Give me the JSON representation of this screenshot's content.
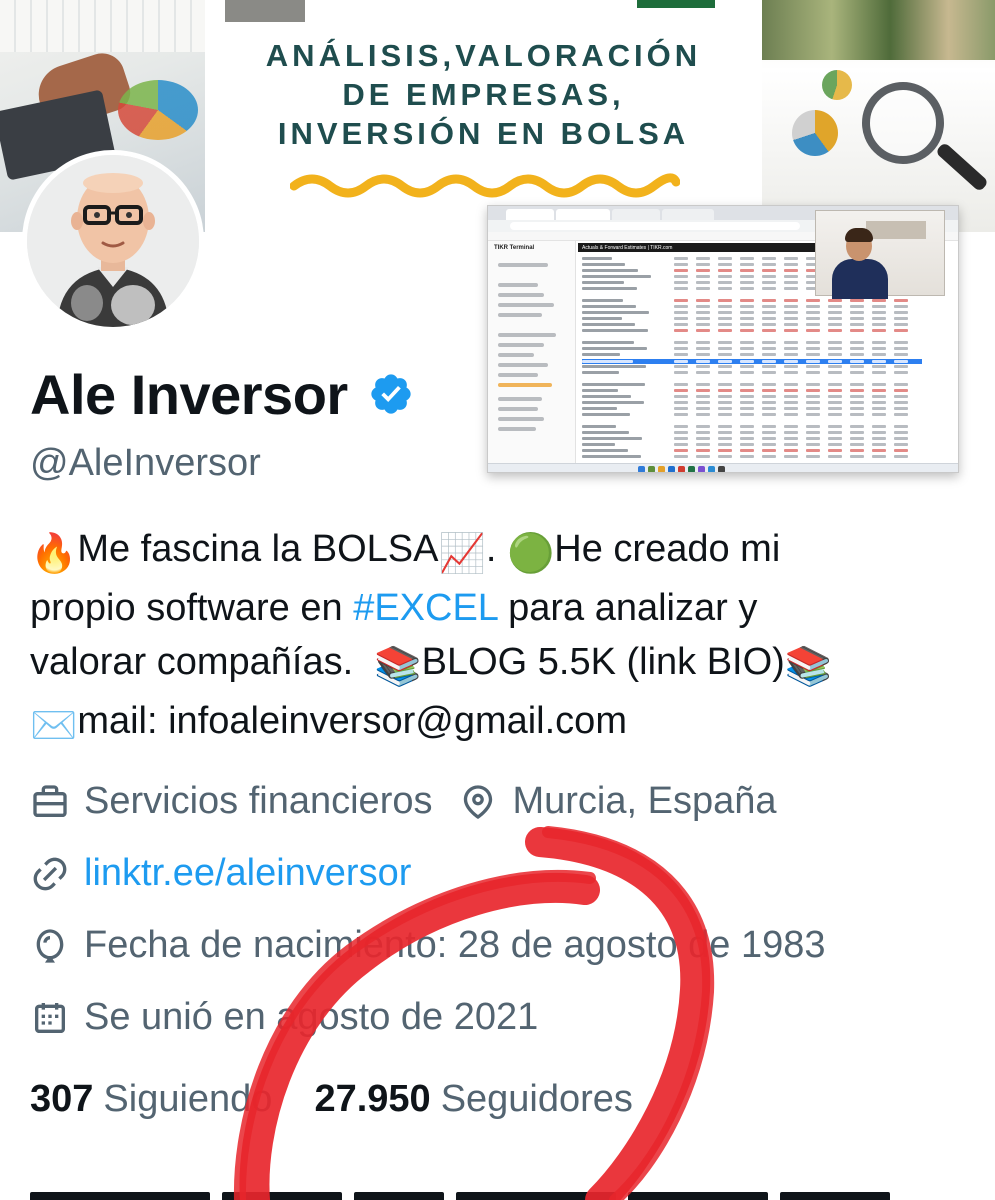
{
  "banner": {
    "title_lines": [
      "ANÁLISIS,VALORACIÓN",
      "DE EMPRESAS,",
      "INVERSIÓN EN BOLSA"
    ],
    "title_color": "#1f4d4e",
    "wave_color": "#f2b21c"
  },
  "embedded_screenshot": {
    "app_name": "TIKR Terminal",
    "table_title": "Actuals & Forward Estimates | TIKR.com"
  },
  "profile": {
    "display_name": "Ale Inversor",
    "handle": "@AleInversor",
    "verified_color": "#1d9bf0",
    "bio": {
      "line1_emoji1": "🔥",
      "line1_text1": "Me fascina la BOLSA",
      "line1_emoji2": "📈",
      "line1_text2": ". ",
      "line1_emoji3": "🟢",
      "line1_text3": "He creado mi",
      "line2_text1": "propio software en ",
      "line2_hashtag": "#EXCEL",
      "line2_text2": " para analizar y",
      "line3_text1": "valorar compañías.  ",
      "line3_emoji1": "📚",
      "line3_text2": "BLOG 5.5K (link BIO)",
      "line3_emoji2": "📚",
      "line4_emoji": "✉️",
      "line4_text": "mail: infoaleinversor@gmail.com"
    },
    "category": "Servicios financieros",
    "location": "Murcia, España",
    "website": "linktr.ee/aleinversor",
    "birthday": "Fecha de nacimiento: 28 de agosto de 1983",
    "joined": "Se unió en agosto de 2021",
    "following_count": "307",
    "following_label": "Siguiendo",
    "followers_count": "27.950",
    "followers_label": "Seguidores"
  },
  "icons": {
    "category": "briefcase-icon",
    "location": "map-pin-icon",
    "website": "link-icon",
    "birthday": "balloon-icon",
    "joined": "calendar-icon"
  },
  "colors": {
    "text_primary": "#0f1419",
    "text_secondary": "#536471",
    "link": "#1d9bf0",
    "annotation": "#e8262c"
  }
}
